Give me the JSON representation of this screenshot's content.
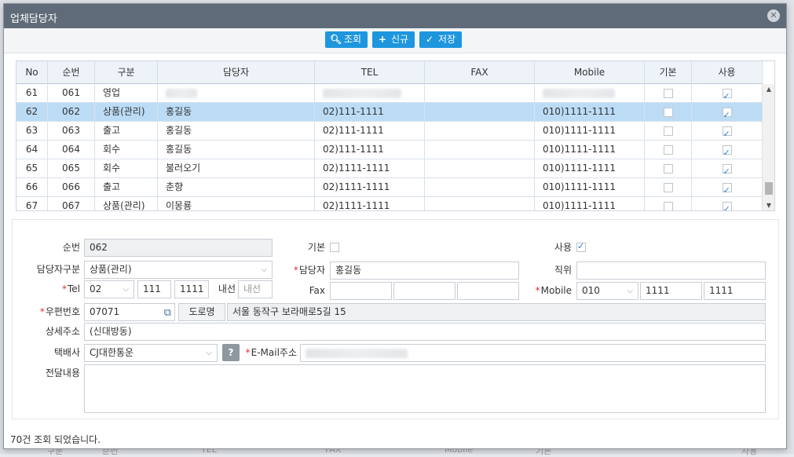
{
  "window": {
    "title": "업체담당자"
  },
  "toolbar": {
    "search_label": "조회",
    "new_label": "신규",
    "save_label": "저장"
  },
  "grid": {
    "headers": [
      "No",
      "순번",
      "구분",
      "담당자",
      "TEL",
      "FAX",
      "Mobile",
      "기본",
      "사용"
    ],
    "rows": [
      {
        "no": "61",
        "seq": "061",
        "type": "영업",
        "person": "",
        "tel": "",
        "fax": "",
        "mobile": "",
        "default": false,
        "use": true,
        "blurred": true
      },
      {
        "no": "62",
        "seq": "062",
        "type": "상품(관리)",
        "person": "홍길동",
        "tel": "02)111-1111",
        "fax": "",
        "mobile": "010)1111-1111",
        "default": false,
        "use": true
      },
      {
        "no": "63",
        "seq": "063",
        "type": "출고",
        "person": "홍길동",
        "tel": "02)111-1111",
        "fax": "",
        "mobile": "010)1111-1111",
        "default": false,
        "use": true
      },
      {
        "no": "64",
        "seq": "064",
        "type": "회수",
        "person": "홍길동",
        "tel": "02)111-1111",
        "fax": "",
        "mobile": "010)1111-1111",
        "default": false,
        "use": true
      },
      {
        "no": "65",
        "seq": "065",
        "type": "회수",
        "person": "불러오기",
        "tel": "02)1111-1111",
        "fax": "",
        "mobile": "010)1111-1111",
        "default": false,
        "use": true
      },
      {
        "no": "66",
        "seq": "066",
        "type": "출고",
        "person": "춘향",
        "tel": "02)1111-1111",
        "fax": "",
        "mobile": "010)1111-1111",
        "default": false,
        "use": true
      },
      {
        "no": "67",
        "seq": "067",
        "type": "상품(관리)",
        "person": "이몽룡",
        "tel": "02)1111-1111",
        "fax": "",
        "mobile": "010)1111-1111",
        "default": false,
        "use": true
      }
    ]
  },
  "form": {
    "seq_label": "순번",
    "seq_value": "062",
    "default_label": "기본",
    "use_label": "사용",
    "type_label": "담당자구분",
    "type_value": "상품(관리)",
    "person_label": "담당자",
    "person_value": "홍길동",
    "position_label": "직위",
    "position_value": "",
    "tel_label": "Tel",
    "tel1": "02",
    "tel2": "111",
    "tel3": "1111",
    "ext_label": "내선",
    "ext_placeholder": "내선",
    "fax_label": "Fax",
    "mobile_label": "Mobile",
    "mobile1": "010",
    "mobile2": "1111",
    "mobile3": "1111",
    "zip_label": "우편번호",
    "zip_value": "07071",
    "road_label": "도로명",
    "address_value": "서울 동작구 보라매로5길 15",
    "detail_label": "상세주소",
    "detail_value": "(신대방동)",
    "courier_label": "택배사",
    "courier_value": "CJ대한통운",
    "help_label": "?",
    "email_label": "E-Mail주소",
    "memo_label": "전달내용"
  },
  "status": {
    "message": "70건 조회 되었습니다."
  },
  "backdrop": {
    "labels": [
      "구분",
      "순번",
      "TEL",
      "FAX",
      "Mobile",
      "기본",
      "사용"
    ]
  }
}
